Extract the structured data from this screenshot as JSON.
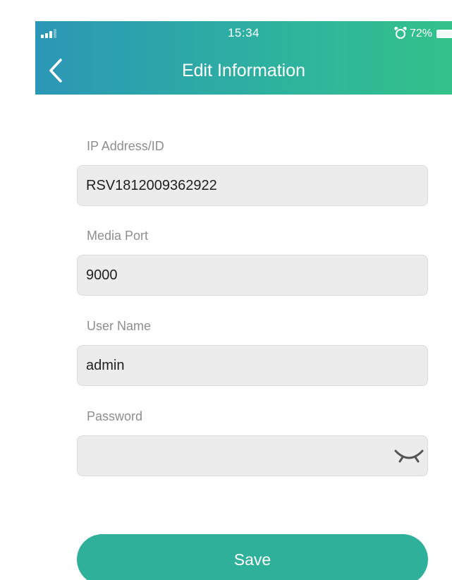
{
  "status_bar": {
    "time": "15:34",
    "battery": "72%",
    "icons": [
      "signal-icon",
      "alarm-icon",
      "battery-icon"
    ]
  },
  "nav": {
    "title": "Edit Information",
    "back_icon": "chevron-left-icon"
  },
  "form": {
    "fields": [
      {
        "label": "IP Address/ID",
        "value": "RSV1812009362922"
      },
      {
        "label": "Media Port",
        "value": "9000"
      },
      {
        "label": "User Name",
        "value": "admin"
      },
      {
        "label": "Password",
        "value": ""
      }
    ],
    "password_toggle_icon": "eye-closed-icon",
    "save_label": "Save"
  },
  "colors": {
    "header_gradient_start": "#2b97b6",
    "header_gradient_end": "#33c189",
    "accent": "#2fb09a",
    "field_bg": "#ececec",
    "label_text": "#8e8e8e"
  }
}
